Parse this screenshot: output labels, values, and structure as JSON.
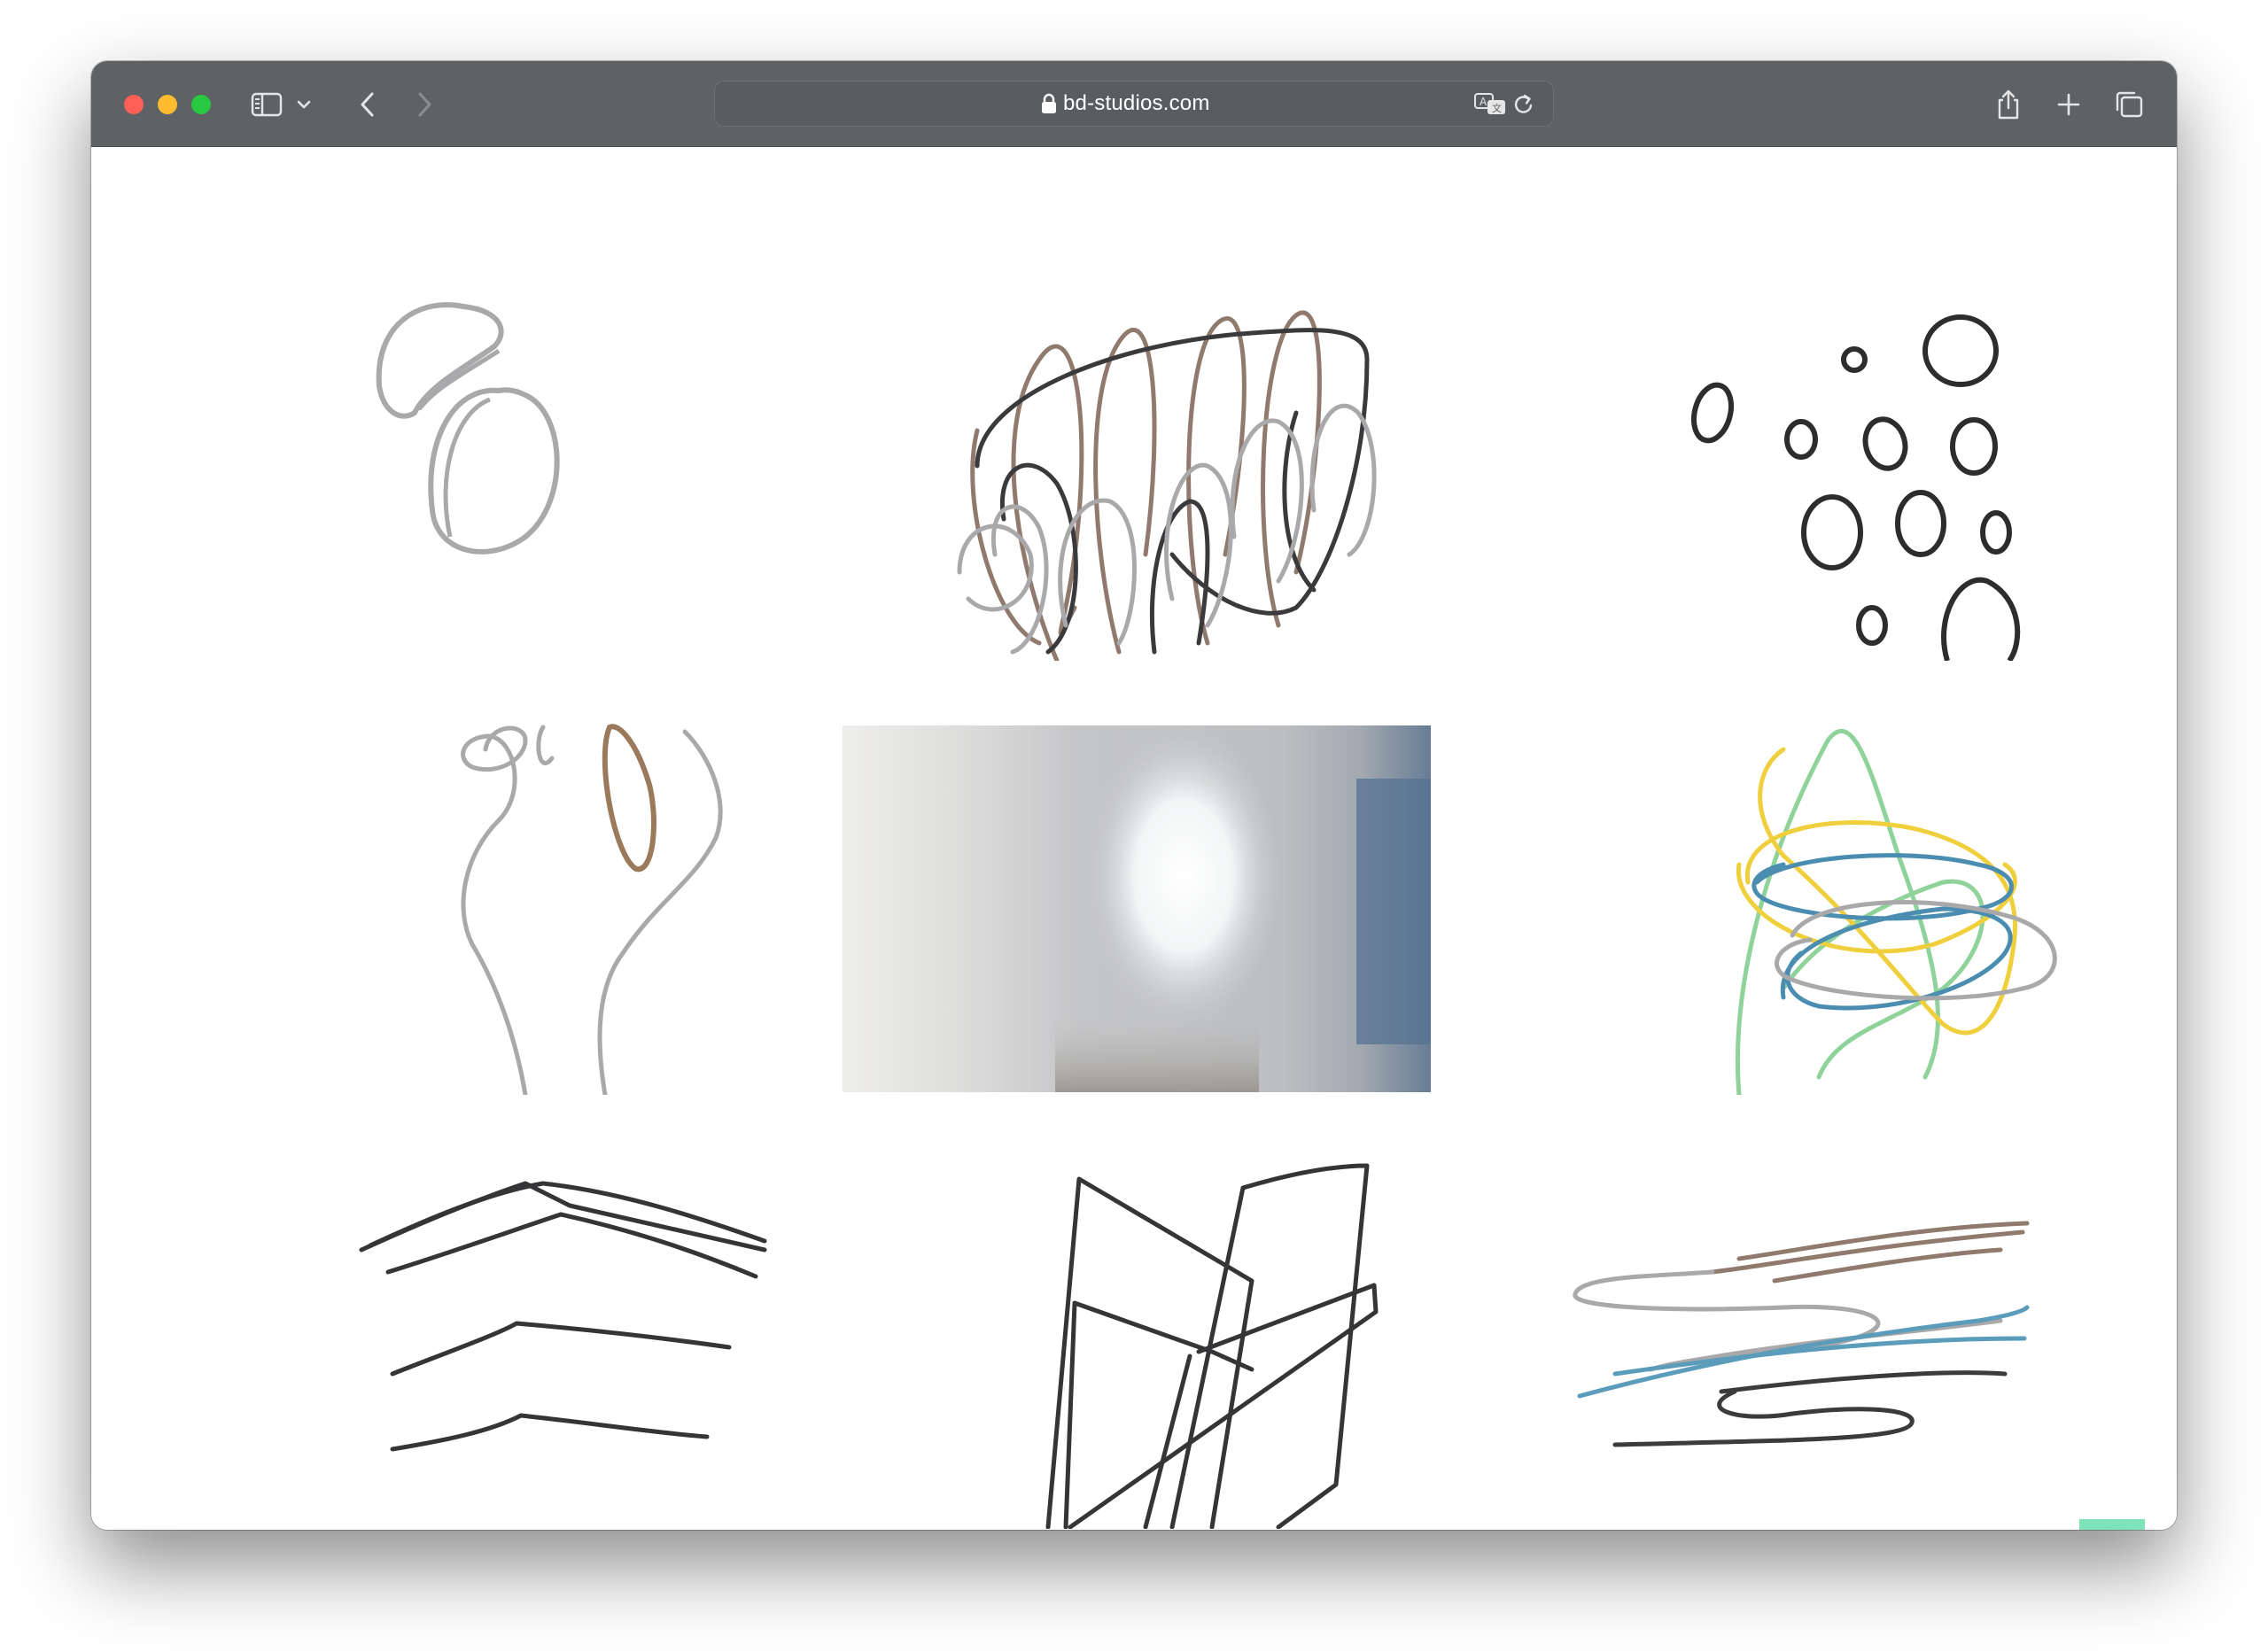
{
  "browser": {
    "url": "bd-studios.com",
    "accent_scroll_button": "#7fe3b9",
    "toolbar_color": "#5f6265"
  },
  "icons": {
    "sidebar": "sidebar-icon",
    "chevron_down": "chevron-down-icon",
    "back": "back-arrow-icon",
    "forward": "forward-arrow-icon",
    "lock": "lock-icon",
    "translate": "translate-icon",
    "reload": "reload-icon",
    "share": "share-icon",
    "new_tab": "plus-icon",
    "tabs": "tabs-overview-icon",
    "scroll_top": "chevron-up-icon"
  },
  "gallery": {
    "items": [
      {
        "kind": "drawing",
        "subject": "two grey bean shapes"
      },
      {
        "kind": "drawing",
        "subject": "brown, black and grey scribble"
      },
      {
        "kind": "drawing",
        "subject": "black scattered circles"
      },
      {
        "kind": "drawing",
        "subject": "grey flower stem with brown loop"
      },
      {
        "kind": "photo",
        "subject": "frosted glass texture"
      },
      {
        "kind": "drawing",
        "subject": "yellow, green, blue and grey loops"
      },
      {
        "kind": "drawing",
        "subject": "black chevron lines"
      },
      {
        "kind": "drawing",
        "subject": "black angular chair lines"
      },
      {
        "kind": "drawing",
        "subject": "brown, grey, blue and black horizontal strokes"
      }
    ]
  }
}
